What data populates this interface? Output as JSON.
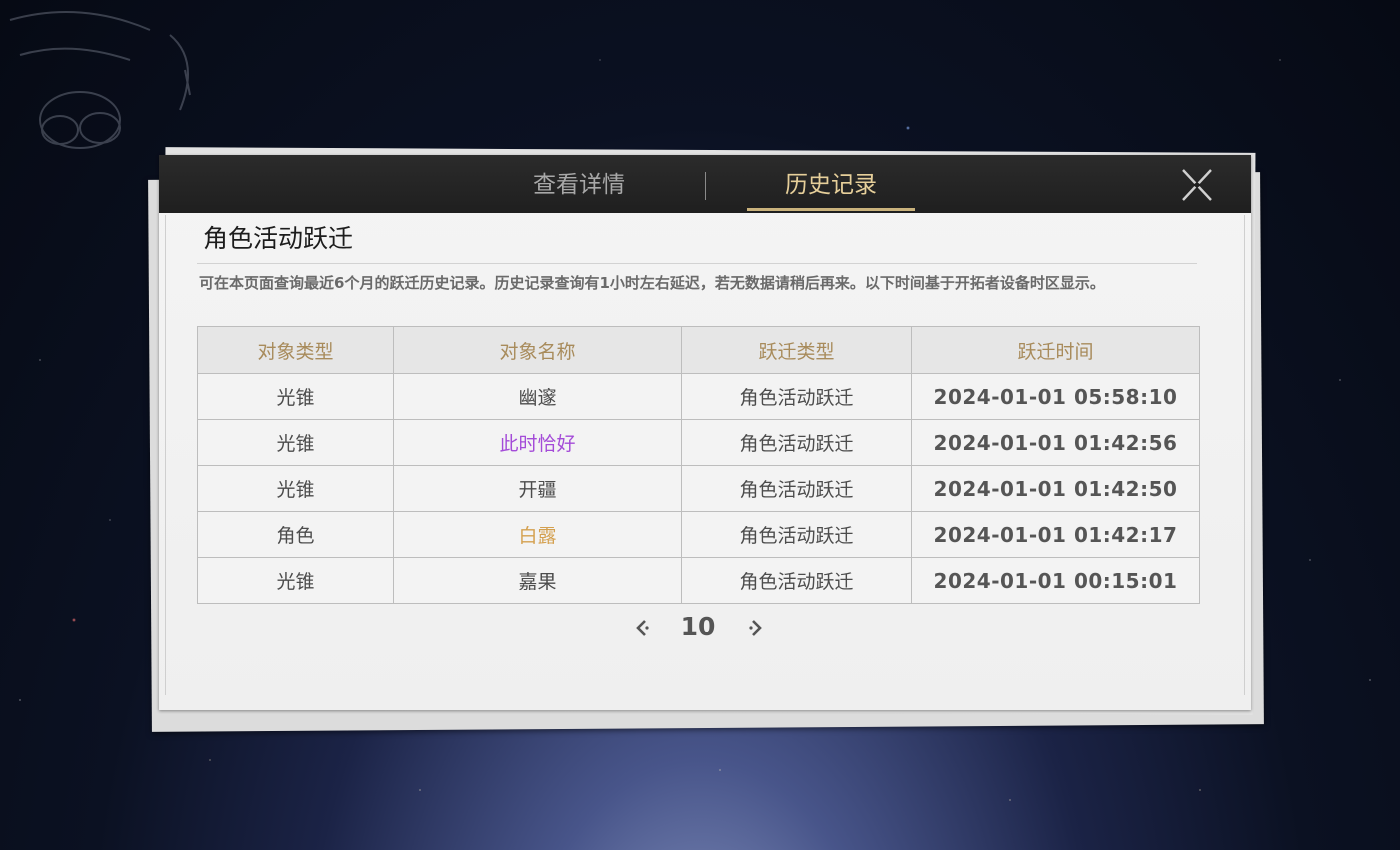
{
  "tabs": {
    "details_label": "查看详情",
    "history_label": "历史记录"
  },
  "title": "角色活动跃迁",
  "description": "可在本页面查询最近6个月的跃迁历史记录。历史记录查询有1小时左右延迟，若无数据请稍后再来。以下时间基于开拓者设备时区显示。",
  "table": {
    "headers": [
      "对象类型",
      "对象名称",
      "跃迁类型",
      "跃迁时间"
    ],
    "rows": [
      {
        "type": "光锥",
        "name": "幽邃",
        "warp": "角色活动跃迁",
        "time": "2024-01-01 05:58:10"
      },
      {
        "type": "光锥",
        "name": "此时恰好",
        "warp": "角色活动跃迁",
        "time": "2024-01-01 01:42:56"
      },
      {
        "type": "光锥",
        "name": "开疆",
        "warp": "角色活动跃迁",
        "time": "2024-01-01 01:42:50"
      },
      {
        "type": "角色",
        "name": "白露",
        "warp": "角色活动跃迁",
        "time": "2024-01-01 01:42:17"
      },
      {
        "type": "光锥",
        "name": "嘉果",
        "warp": "角色活动跃迁",
        "time": "2024-01-01 00:15:01"
      }
    ]
  },
  "pager": {
    "page": "10"
  },
  "colors": {
    "rarity_4_star": "#a44bd8",
    "rarity_5_star": "#d4a04f",
    "header_text": "#a88b5b",
    "active_tab": "#e6cf9a"
  },
  "icons": {
    "close": "close-x-icon",
    "prev": "chevron-left-icon",
    "next": "chevron-right-icon"
  }
}
